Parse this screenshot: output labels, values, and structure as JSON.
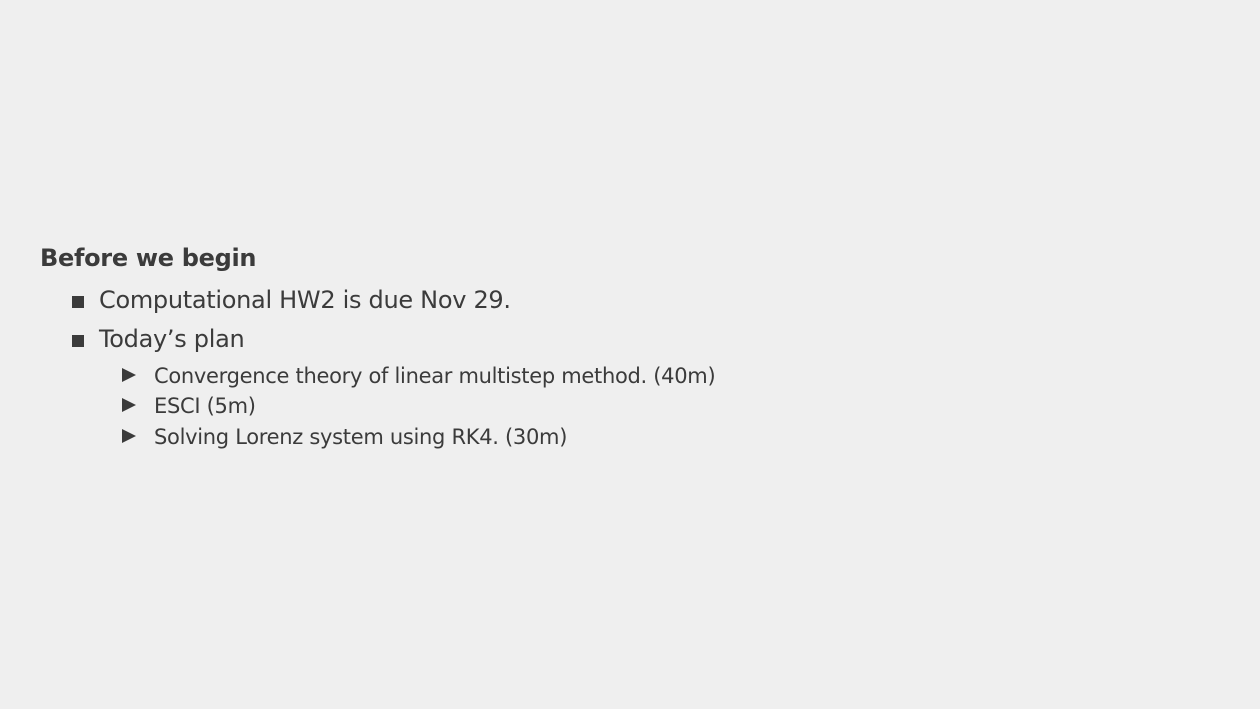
{
  "slide": {
    "block_title": "Before we begin",
    "items": [
      {
        "text": "Computational HW2 is due Nov 29."
      },
      {
        "text": "Today’s plan"
      }
    ],
    "subitems": [
      {
        "text": "Convergence theory of linear multistep method. (40m)"
      },
      {
        "text": "ESCI (5m)"
      },
      {
        "text": "Solving Lorenz system using RK4. (30m)"
      }
    ],
    "colors": {
      "background": "#efefef",
      "text": "#3b3b3b"
    },
    "icons": {
      "item_bullet": "square-bullet-icon",
      "subitem_bullet": "triangle-bullet-icon"
    }
  }
}
